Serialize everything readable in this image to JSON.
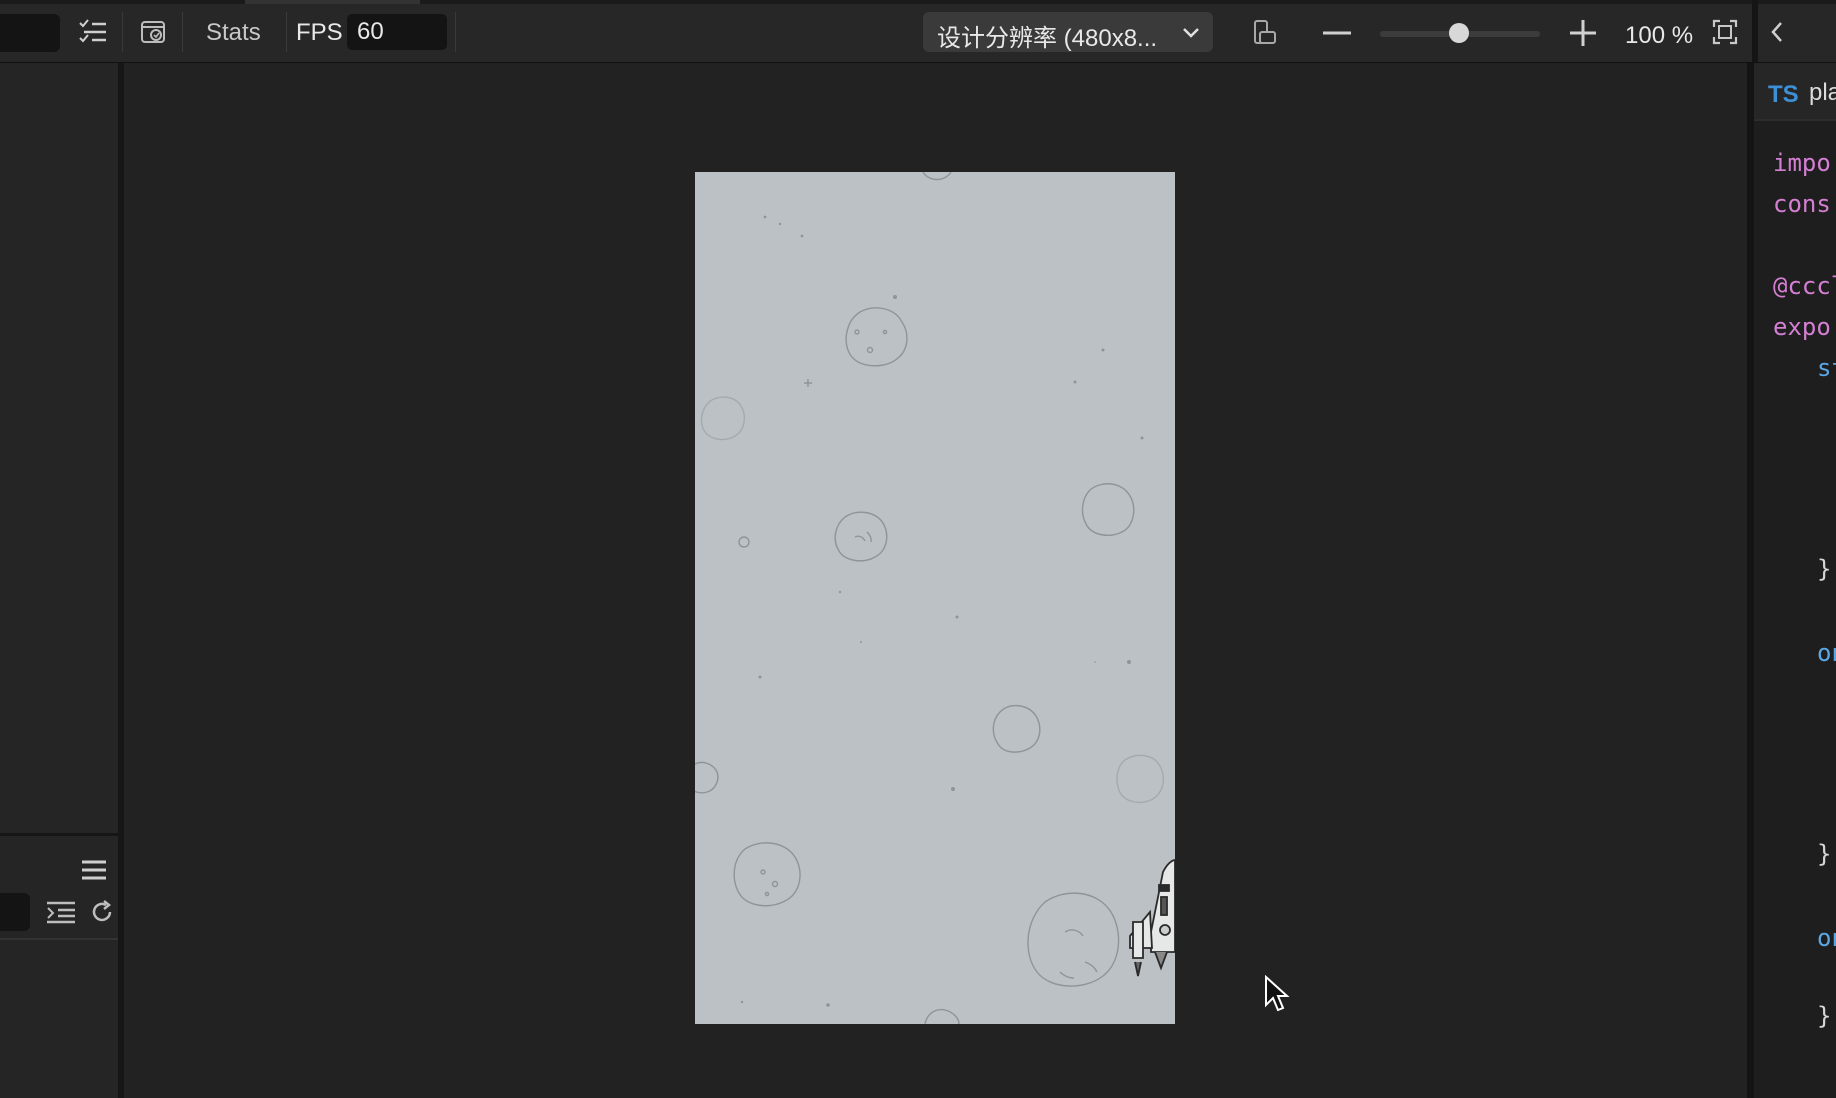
{
  "toolbar": {
    "stats_label": "Stats",
    "fps_label": "FPS",
    "fps_value": "60",
    "resolution_label": "设计分辨率 (480x8...",
    "zoom_label": "100 %"
  },
  "right_panel": {
    "tab_type": "TS",
    "tab_name": "play",
    "code_lines": [
      "impo",
      "cons",
      "@cccl",
      "expo",
      "st",
      "}",
      "on",
      "}",
      "on",
      "}"
    ]
  },
  "icons": {
    "list": "list-check-icon",
    "scene_camera": "scene-camera-icon",
    "resolution_chevron": "chevron-down-icon",
    "rotate": "rotate-device-icon",
    "zoom_out": "minus-icon",
    "zoom_in": "plus-icon",
    "fit": "fit-screen-icon",
    "collapse": "chevron-left-icon",
    "menu": "hamburger-menu-icon",
    "indent": "indent-icon",
    "refresh": "refresh-icon"
  }
}
